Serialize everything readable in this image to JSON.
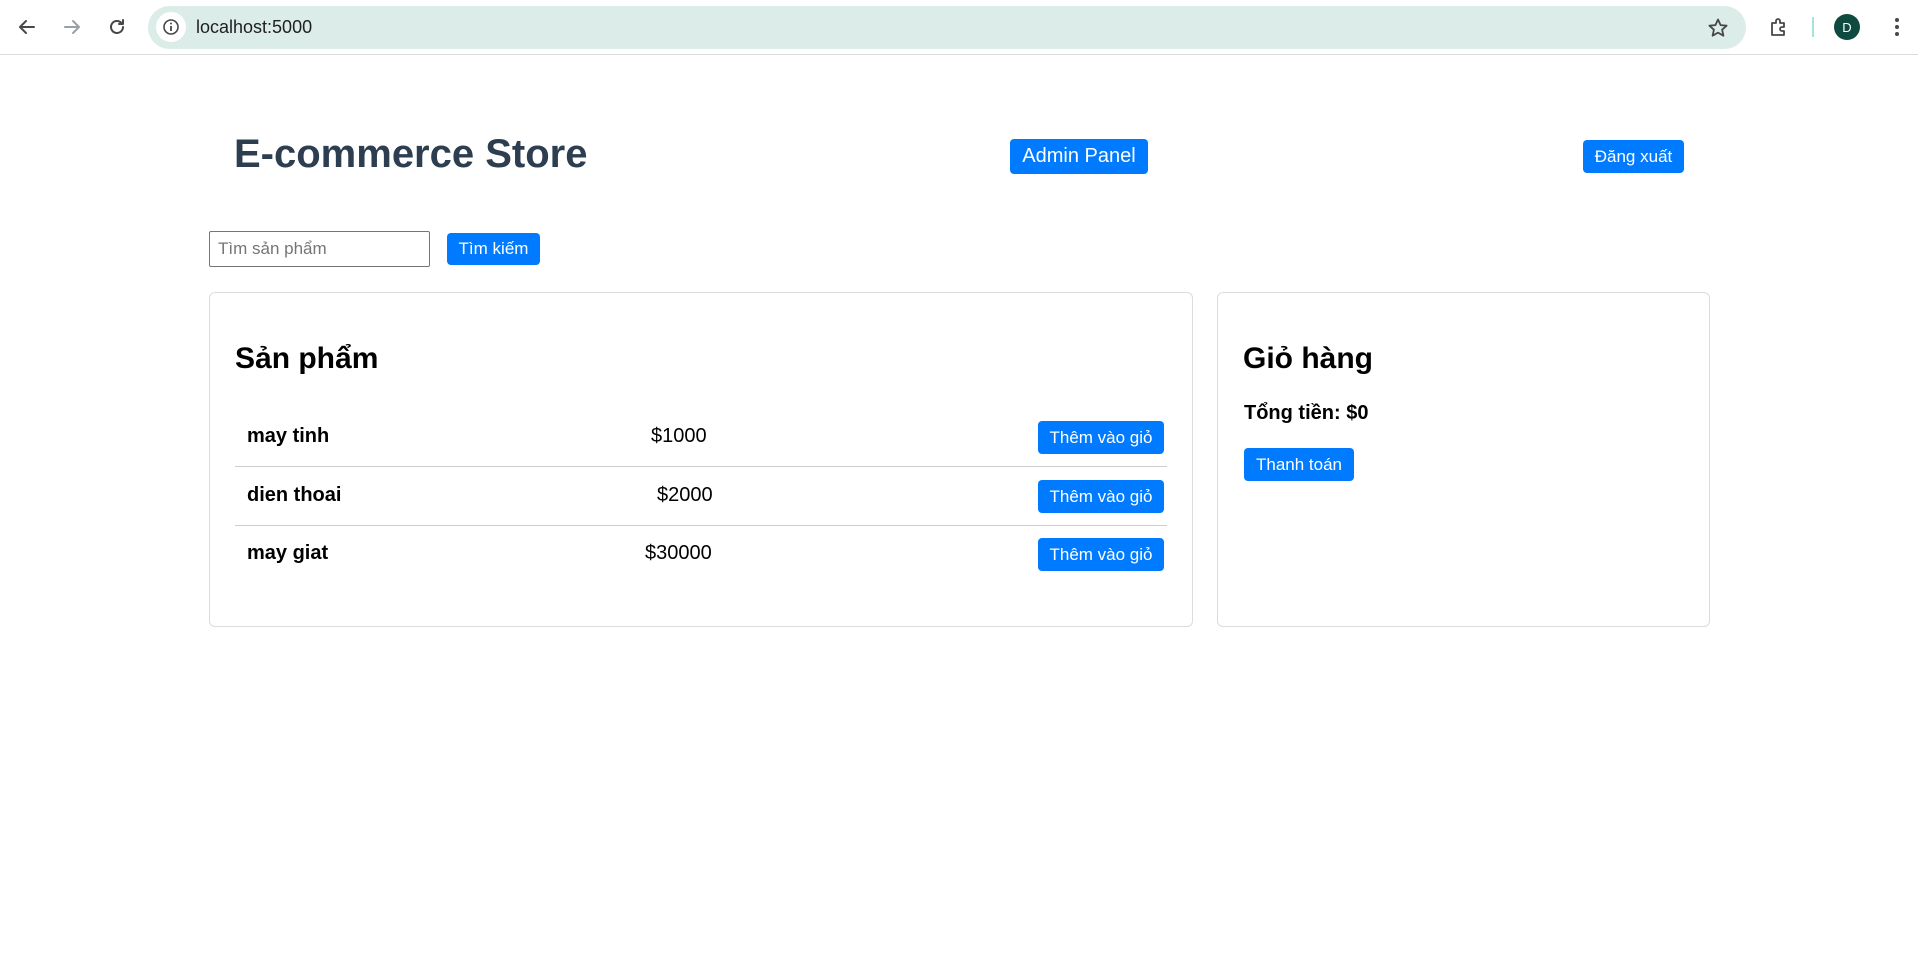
{
  "browser": {
    "url": "localhost:5000",
    "profile_initial": "D",
    "icons": {
      "back": "back-arrow-icon",
      "forward": "forward-arrow-icon",
      "reload": "reload-icon",
      "site_info": "info-icon",
      "bookmark": "star-icon",
      "extensions": "puzzle-icon",
      "menu": "kebab-menu-icon"
    }
  },
  "header": {
    "title": "E-commerce Store",
    "admin_label": "Admin Panel",
    "logout_label": "Đăng xuất"
  },
  "search": {
    "placeholder": "Tìm sản phẩm",
    "value": "",
    "button_label": "Tìm kiếm"
  },
  "products": {
    "heading": "Sản phẩm",
    "items": [
      {
        "name": "may tinh",
        "price": "$1000",
        "add_label": "Thêm vào giỏ"
      },
      {
        "name": "dien thoai",
        "price": "$2000",
        "add_label": "Thêm vào giỏ"
      },
      {
        "name": "may giat",
        "price": "$30000",
        "add_label": "Thêm vào giỏ"
      }
    ]
  },
  "cart": {
    "heading": "Giỏ hàng",
    "total_label": "Tổng tiền: $0",
    "checkout_label": "Thanh toán"
  },
  "colors": {
    "primary": "#007bff",
    "title": "#2c3e50",
    "omnibox": "#dcece8",
    "avatar": "#0e4a3f"
  }
}
